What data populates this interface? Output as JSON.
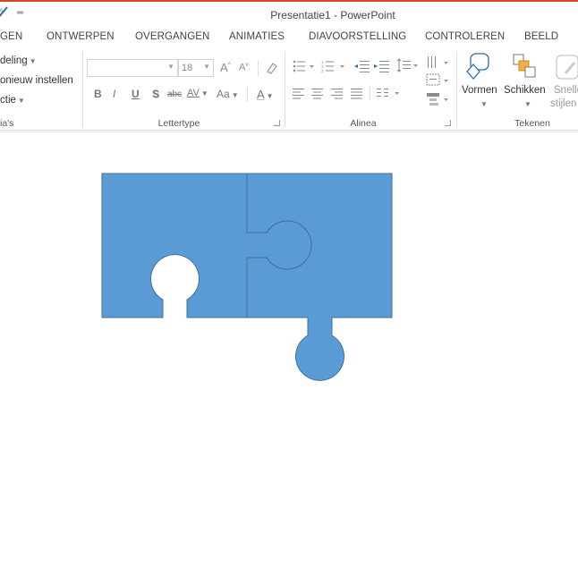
{
  "window": {
    "title": "Presentatie1 - PowerPoint"
  },
  "tabs": [
    "GEN",
    "ONTWERPEN",
    "OVERGANGEN",
    "ANIMATIES",
    "DIAVOORSTELLING",
    "CONTROLEREN",
    "BEELD"
  ],
  "slides_group": {
    "layout": "deling",
    "reset": "onieuw instellen",
    "section": "ctie",
    "label": "ia's"
  },
  "font_group": {
    "font_name": "",
    "font_size": "18",
    "grow": "A",
    "shrink": "A",
    "bold": "B",
    "italic": "I",
    "underline": "U",
    "shadow": "S",
    "strike": "abc",
    "spacing": "AV",
    "case": "Aa",
    "color": "A",
    "label": "Lettertype"
  },
  "paragraph_group": {
    "label": "Alinea"
  },
  "drawing_group": {
    "shapes": "Vormen",
    "arrange": "Schikken",
    "quick_styles_1": "Snelle",
    "quick_styles_2": "stijlen",
    "label": "Tekenen"
  },
  "colors": {
    "accent": "#d24726",
    "puzzle_fill": "#5b9bd5",
    "puzzle_stroke": "#41719c",
    "arrange_orange": "#f0b142"
  }
}
